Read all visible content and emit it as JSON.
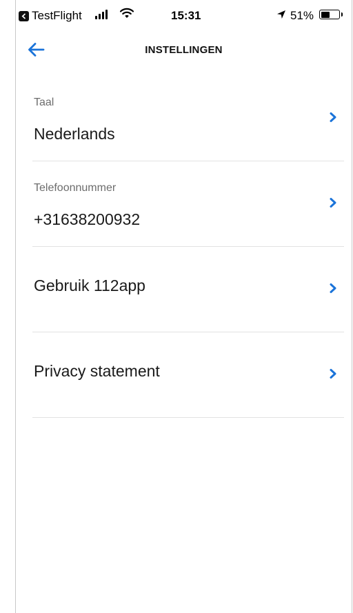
{
  "status_bar": {
    "back_app": "TestFlight",
    "time": "15:31",
    "battery_percent": "51%",
    "battery_level": 0.51,
    "icons": [
      "back-app-icon",
      "signal-icon",
      "wifi-icon",
      "location-arrow-icon",
      "battery-icon"
    ]
  },
  "nav": {
    "title": "INSTELLINGEN",
    "back_icon": "arrow-left-icon"
  },
  "settings": [
    {
      "label": "Taal",
      "value": "Nederlands"
    },
    {
      "label": "Telefoonnummer",
      "value": "+31638200932"
    },
    {
      "label": "",
      "value": "Gebruik 112app"
    },
    {
      "label": "",
      "value": "Privacy statement"
    }
  ],
  "colors": {
    "accent": "#1a73d9",
    "divider": "#e2e2e2",
    "label": "#6c6c6c"
  }
}
